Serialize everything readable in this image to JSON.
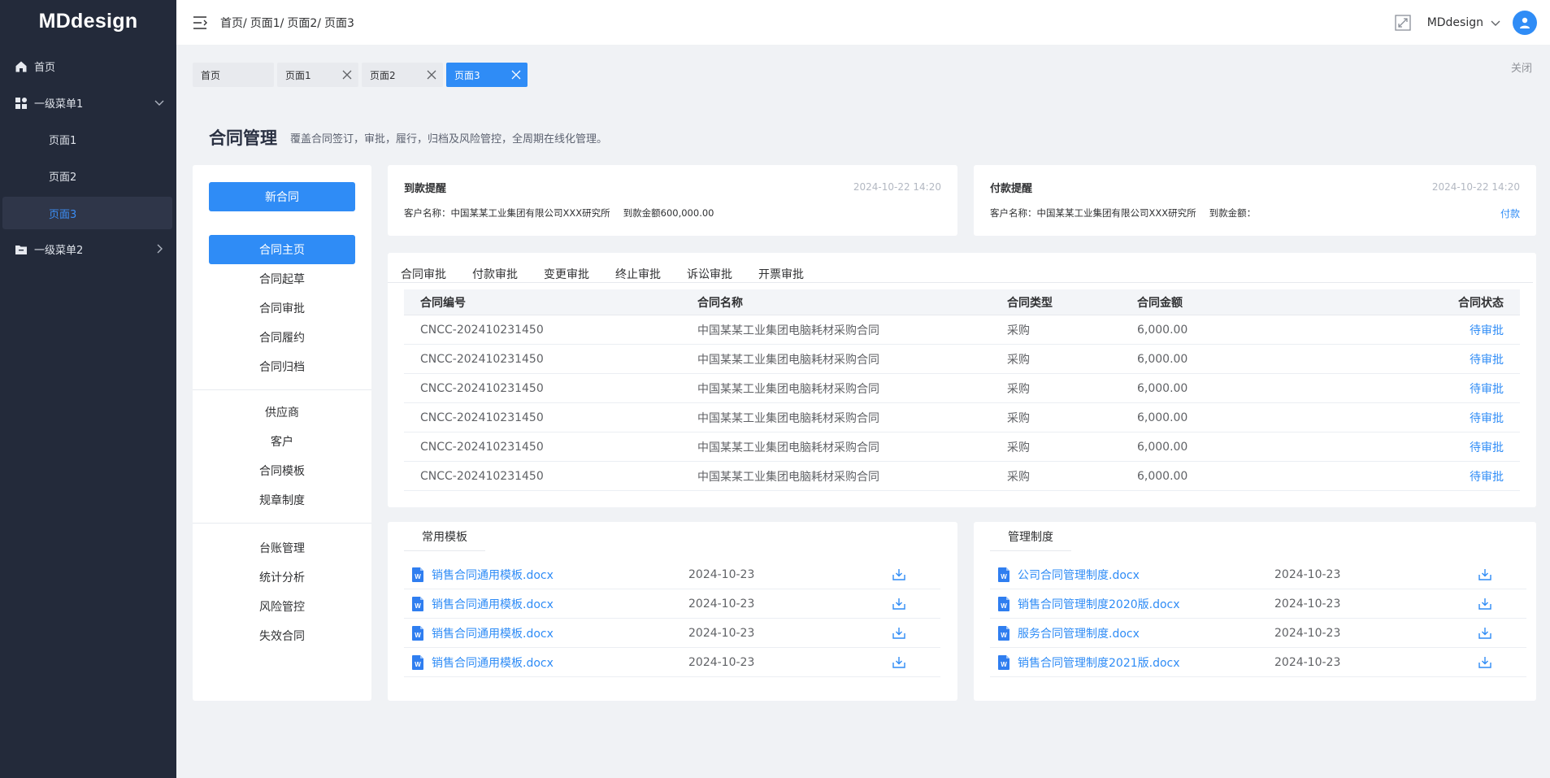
{
  "app": {
    "logo": "MDdesign"
  },
  "sidebar": {
    "home": "首页",
    "menu1": "一级菜单1",
    "pages": [
      "页面1",
      "页面2",
      "页面3"
    ],
    "menu2": "一级菜单2"
  },
  "header": {
    "breadcrumb": [
      "首页/",
      "页面1/",
      "页面2/",
      "页面3"
    ],
    "user": "MDdesign"
  },
  "tabs": {
    "items": [
      "首页",
      "页面1",
      "页面2",
      "页面3"
    ],
    "close_all": "关闭"
  },
  "page": {
    "title": "合同管理",
    "description": "覆盖合同签订，审批，履行，归档及风险管控，全周期在线化管理。"
  },
  "left_nav": {
    "new_button": "新合同",
    "group1": [
      "合同主页",
      "合同起草",
      "合同审批",
      "合同履约",
      "合同归档"
    ],
    "group2": [
      "供应商",
      "客户",
      "合同模板",
      "规章制度"
    ],
    "group3": [
      "台账管理",
      "统计分析",
      "风险管控",
      "失效合同"
    ]
  },
  "receipt_reminder": {
    "title": "到款提醒",
    "time": "2024-10-22  14:20",
    "customer": "客户名称：中国某某工业集团有限公司XXX研究所",
    "amount": "到款金额600,000.00"
  },
  "payment_reminder": {
    "title": "付款提醒",
    "time": "2024-10-22  14:20",
    "customer": "客户名称：中国某某工业集团有限公司XXX研究所",
    "amount": "到款金额：",
    "action": "付款"
  },
  "approval_tabs": [
    "合同审批",
    "付款审批",
    "变更审批",
    "终止审批",
    "诉讼审批",
    "开票审批"
  ],
  "table": {
    "headers": [
      "合同编号",
      "合同名称",
      "合同类型",
      "合同金额",
      "合同状态"
    ],
    "rows": [
      [
        "CNCC-202410231450",
        "中国某某工业集团电脑耗材采购合同",
        "采购",
        "6,000.00",
        "待审批"
      ],
      [
        "CNCC-202410231450",
        "中国某某工业集团电脑耗材采购合同",
        "采购",
        "6,000.00",
        "待审批"
      ],
      [
        "CNCC-202410231450",
        "中国某某工业集团电脑耗材采购合同",
        "采购",
        "6,000.00",
        "待审批"
      ],
      [
        "CNCC-202410231450",
        "中国某某工业集团电脑耗材采购合同",
        "采购",
        "6,000.00",
        "待审批"
      ],
      [
        "CNCC-202410231450",
        "中国某某工业集团电脑耗材采购合同",
        "采购",
        "6,000.00",
        "待审批"
      ],
      [
        "CNCC-202410231450",
        "中国某某工业集团电脑耗材采购合同",
        "采购",
        "6,000.00",
        "待审批"
      ]
    ]
  },
  "templates": {
    "title": "常用模板",
    "files": [
      {
        "name": "销售合同通用模板.docx",
        "date": "2024-10-23"
      },
      {
        "name": "销售合同通用模板.docx",
        "date": "2024-10-23"
      },
      {
        "name": "销售合同通用模板.docx",
        "date": "2024-10-23"
      },
      {
        "name": "销售合同通用模板.docx",
        "date": "2024-10-23"
      }
    ]
  },
  "rules": {
    "title": "管理制度",
    "files": [
      {
        "name": "公司合同管理制度.docx",
        "date": "2024-10-23"
      },
      {
        "name": "销售合同管理制度2020版.docx",
        "date": "2024-10-23"
      },
      {
        "name": "服务合同管理制度.docx",
        "date": "2024-10-23"
      },
      {
        "name": "销售合同管理制度2021版.docx",
        "date": "2024-10-23"
      }
    ]
  },
  "colors": {
    "primary": "#2f8cf6",
    "sidebar": "#232a3a",
    "background": "#f0f2f5"
  }
}
